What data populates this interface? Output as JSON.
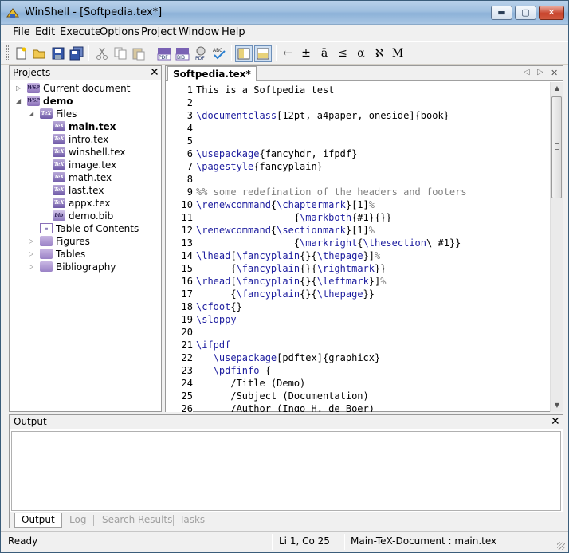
{
  "window": {
    "title": "WinShell - [Softpedia.tex*]",
    "min_glyph": "▬",
    "max_glyph": "▢",
    "close_glyph": "✕"
  },
  "menu": [
    "File",
    "Edit",
    "Execute",
    "Options",
    "Project",
    "Window",
    "Help"
  ],
  "toolbar": {
    "icons": [
      "new-file-icon",
      "open-folder-icon",
      "save-icon",
      "save-all-icon",
      "cut-icon",
      "copy-icon",
      "paste-icon",
      "latex-pdf-icon",
      "bibtex-icon",
      "pdf-view-icon",
      "spellcheck-icon",
      "layout-split-vertical-icon",
      "layout-split-horizontal-icon"
    ],
    "symbols": [
      "←",
      "±",
      "ā",
      "≤",
      "α",
      "ℵ",
      "M"
    ]
  },
  "projects": {
    "title": "Projects",
    "close": "✕",
    "tree": [
      {
        "label": "Current document",
        "expander": "▷",
        "icon": "wsp"
      },
      {
        "label": "demo",
        "expander": "◢",
        "icon": "wsp",
        "bold": true
      },
      {
        "label": "Files",
        "expander": "◢",
        "icon": "tex"
      },
      {
        "label": "main.tex",
        "icon": "tex",
        "bold": true
      },
      {
        "label": "intro.tex",
        "icon": "tex"
      },
      {
        "label": "winshell.tex",
        "icon": "tex"
      },
      {
        "label": "image.tex",
        "icon": "tex"
      },
      {
        "label": "math.tex",
        "icon": "tex"
      },
      {
        "label": "last.tex",
        "icon": "tex"
      },
      {
        "label": "appx.tex",
        "icon": "tex"
      },
      {
        "label": "demo.bib",
        "icon": "bib"
      },
      {
        "label": "Table of Contents",
        "icon": "toc"
      },
      {
        "label": "Figures",
        "expander": "▷",
        "icon": "doc"
      },
      {
        "label": "Tables",
        "expander": "▷",
        "icon": "doc"
      },
      {
        "label": "Bibliography",
        "expander": "▷",
        "icon": "doc"
      }
    ]
  },
  "editor": {
    "tab_label": "Softpedia.tex*",
    "tab_prev": "◁",
    "tab_next": "▷",
    "tab_close": "✕",
    "lines": [
      "This is a Softpedia test",
      "",
      "\\documentclass[12pt, a4paper, oneside]{book}",
      "",
      "",
      "\\usepackage{fancyhdr, ifpdf}",
      "\\pagestyle{fancyplain}",
      "",
      "%% some redefination of the headers and footers",
      "\\renewcommand{\\chaptermark}[1]%",
      "                 {\\markboth{#1}{}}",
      "\\renewcommand{\\sectionmark}[1]%",
      "                 {\\markright{\\thesection\\ #1}}",
      "\\lhead[\\fancyplain{}{\\thepage}]%",
      "      {\\fancyplain{}{\\rightmark}}",
      "\\rhead[\\fancyplain{}{\\leftmark}]%",
      "      {\\fancyplain{}{\\thepage}}",
      "\\cfoot{}",
      "\\sloppy",
      "",
      "\\ifpdf",
      "   \\usepackage[pdftex]{graphicx}",
      "   \\pdfinfo {",
      "      /Title (Demo)",
      "      /Subject (Documentation)",
      "      /Author (Ingo H. de Boer)"
    ],
    "scroll_up": "▲",
    "scroll_down": "▼"
  },
  "output": {
    "title": "Output",
    "close": "✕",
    "tabs": [
      "Output",
      "Log",
      "Search Results",
      "Tasks"
    ]
  },
  "status": {
    "ready": "Ready",
    "position": "Li 1, Co 25",
    "main_doc": "Main-TeX-Document : main.tex"
  },
  "colors": {
    "keyword": "#1d1d9f",
    "comment": "#808080",
    "icon_purple": "#8a70b8"
  }
}
